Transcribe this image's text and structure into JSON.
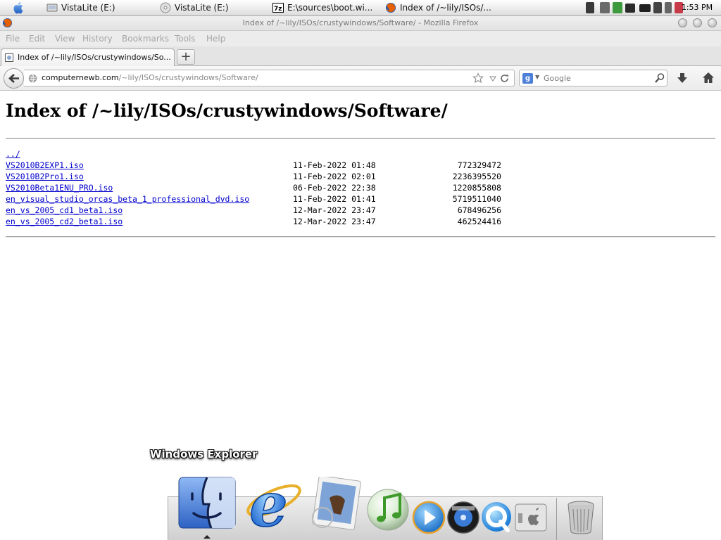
{
  "taskbar": {
    "tasks": [
      {
        "label": "VistaLite (E:)",
        "icon": "drive-icon"
      },
      {
        "label": "VistaLite (E:)",
        "icon": "cd-icon"
      },
      {
        "label": "E:\\sources\\boot.wi...",
        "icon": "7zip-icon"
      },
      {
        "label": "Index of /~lily/ISOs/...",
        "icon": "firefox-icon"
      }
    ],
    "tray_icons": [
      "person-icon",
      "network-icon",
      "recycle-icon",
      "monitor-icon",
      "battery-icon",
      "dropbox-icon",
      "volume-icon",
      "security-icon"
    ],
    "clock": "1:53 PM"
  },
  "window": {
    "title": "Index of /~lily/ISOs/crustywindows/Software/ - Mozilla Firefox"
  },
  "menu": [
    "File",
    "Edit",
    "View",
    "History",
    "Bookmarks",
    "Tools",
    "Help"
  ],
  "tab": {
    "label": "Index of /~lily/ISOs/crustywindows/So...",
    "new_tab": "+"
  },
  "navbar": {
    "url_host": "computernewb.com",
    "url_path": "/~lily/ISOs/crustywindows/Software/",
    "search_placeholder": "Google",
    "search_engine_icon": "google-icon"
  },
  "content": {
    "heading": "Index of /~lily/ISOs/crustywindows/Software/",
    "parent_link": "../",
    "files": [
      {
        "name": "VS2010B2EXP1.iso",
        "date": "11-Feb-2022 01:48",
        "size": "772329472"
      },
      {
        "name": "VS2010B2Pro1.iso",
        "date": "11-Feb-2022 02:01",
        "size": "2236395520"
      },
      {
        "name": "VS2010Beta1ENU_PRO.iso",
        "date": "06-Feb-2022 22:38",
        "size": "1220855808"
      },
      {
        "name": "en_visual_studio_orcas_beta_1_professional_dvd.iso",
        "date": "11-Feb-2022 01:41",
        "size": "5719511040"
      },
      {
        "name": "en_vs_2005_cd1_beta1.iso",
        "date": "12-Mar-2022 23:47",
        "size": "678496256"
      },
      {
        "name": "en_vs_2005_cd2_beta1.iso",
        "date": "12-Mar-2022 23:47",
        "size": "462524416"
      }
    ]
  },
  "dock": {
    "tooltip": "Windows Explorer",
    "items": [
      "finder-icon",
      "internet-explorer-icon",
      "mail-icon",
      "itunes-icon",
      "media-player-icon",
      "dvd-player-icon",
      "quicktime-icon",
      "system-settings-icon",
      "trash-icon"
    ]
  }
}
